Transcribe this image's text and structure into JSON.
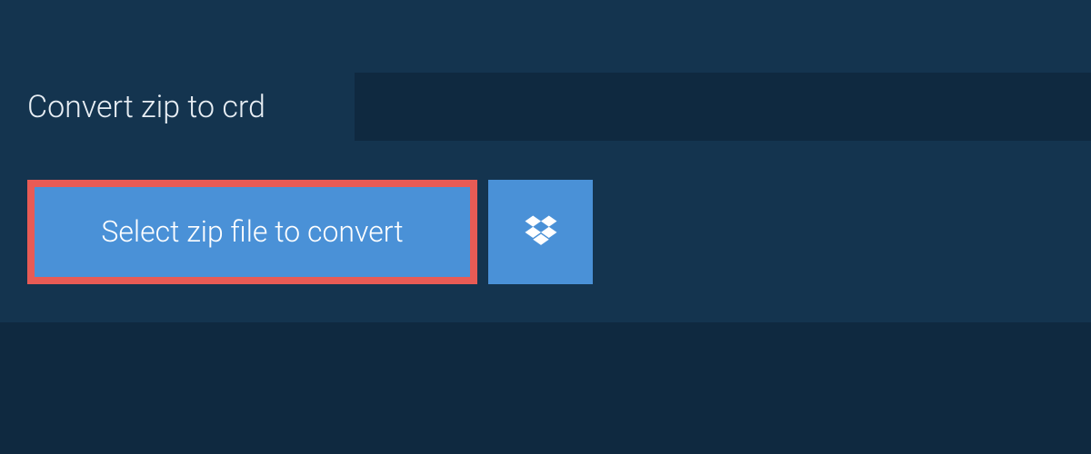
{
  "tab": {
    "label": "Convert zip to crd"
  },
  "actions": {
    "select_file_label": "Select zip file to convert"
  },
  "colors": {
    "bg_outer": "#0f2940",
    "bg_panel": "#14344f",
    "button_bg": "#4a91d7",
    "button_border_highlight": "#e85b55",
    "text_light": "#e8eef4",
    "text_white": "#ffffff"
  }
}
